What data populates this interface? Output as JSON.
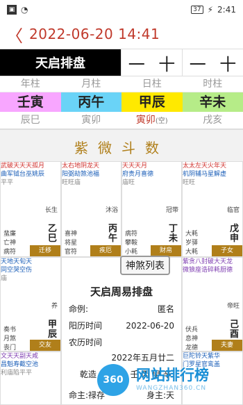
{
  "status": {
    "time": "2:41",
    "battery": "37",
    "charging": "⚡"
  },
  "header": {
    "back": "〈",
    "title": "2022-06-20 14:41"
  },
  "bar": {
    "name": "天启排盘",
    "minus1": "一",
    "plus1": "十",
    "minus2": "一",
    "plus2": "十"
  },
  "pillars": {
    "labels": [
      "年柱",
      "月柱",
      "日柱",
      "时柱"
    ],
    "ganzhi": [
      "壬寅",
      "丙午",
      "甲辰",
      "辛未"
    ],
    "kongwang": [
      "辰巳",
      "寅卯",
      "寅卯",
      "戌亥"
    ],
    "kongwang_note": "(空)"
  },
  "ziwei": "紫微斗数",
  "cells": [
    {
      "stars_top": "武破天天天孤月",
      "stars_2": "曲军钺台巫姚辰",
      "stars_3": "平平",
      "side": "长生",
      "pillar": "乙巳",
      "left": [
        "蜚廉",
        "亡神",
        "病符"
      ],
      "tag": "迁移"
    },
    {
      "stars_top": "太右地阴龙天",
      "stars_2": "阳弼劫煞池福",
      "stars_3": "旺旺庙",
      "side": "沐浴",
      "pillar": "丙午",
      "left": [
        "喜神",
        "将星",
        "官符"
      ],
      "tag": "疾厄"
    },
    {
      "stars_top": "天天天月",
      "stars_2": "府贵月喜德",
      "stars_3": "庙旺",
      "side": "冠带",
      "pillar": "丁未",
      "left": [
        "病符",
        "攀鞍",
        "小耗"
      ],
      "tag": "财帛"
    },
    {
      "stars_top": "太太左天火年天",
      "stars_2": "机阴辅马星解虚",
      "stars_3": "旺旺",
      "side": "临官",
      "pillar": "戊申",
      "left": [
        "大耗",
        "岁驿",
        "大耗"
      ],
      "tag": "子女"
    },
    {
      "stars_top": "天地天旬天",
      "stars_2": "同空哭空伤",
      "stars_3": "庙",
      "side": "养",
      "pillar": "甲辰",
      "left": [
        "奏书",
        "月煞",
        "丧门"
      ],
      "tag": "交友"
    },
    {
      "stars_top": "紫贪八封破大天龙",
      "stars_2": "微狼座诰碎耗厨德",
      "stars_3": "",
      "side": "帝旺",
      "pillar": "己酉",
      "left": [
        "伏兵",
        "息神",
        "龙德"
      ],
      "tag": "夫妻"
    },
    {
      "stars_top": "文天天副天咸",
      "stars_2": "昌魁寿截空池",
      "stars_3": "利庙陷平平",
      "side": "",
      "pillar": "",
      "left": [],
      "tag": ""
    },
    {
      "stars_top": "巨陀铃天紫华",
      "stars_2": "门罗星官鸾盖",
      "stars_3": "",
      "side": "",
      "pillar": "",
      "left": [],
      "tag": ""
    }
  ],
  "center": {
    "shensha": "神煞列表",
    "title": "天启周易排盘",
    "rows": [
      {
        "k": "命例:",
        "v": "匿名"
      },
      {
        "k": "阳历时间",
        "v": "2022-06-20"
      },
      {
        "k": "农历时间",
        "v": "2022年五月廿二"
      },
      {
        "k": "乾造",
        "v": "壬 丙 甲 辛"
      },
      {
        "k": "命主:禄存",
        "v": "身主:天"
      }
    ]
  },
  "watermark": {
    "logo": "360",
    "brand": "网站排行榜",
    "url": "WANGZHAN360.CN"
  }
}
